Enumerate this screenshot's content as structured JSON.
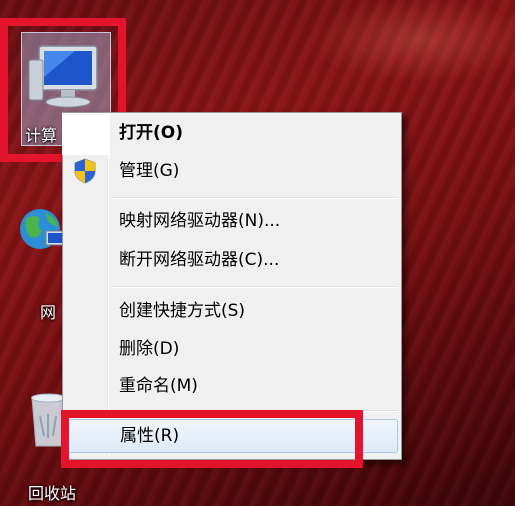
{
  "desktop": {
    "icons": [
      {
        "label": "计算机",
        "visible_label": "计算"
      },
      {
        "label": "网络",
        "visible_label": "网"
      },
      {
        "label": "回收站",
        "visible_label": "回收站"
      }
    ]
  },
  "context_menu": {
    "items": [
      {
        "label": "打开(O)",
        "bold": true
      },
      {
        "label": "管理(G)",
        "icon": "uac-shield-icon"
      },
      {
        "label": "映射网络驱动器(N)..."
      },
      {
        "label": "断开网络驱动器(C)..."
      },
      {
        "label": "创建快捷方式(S)"
      },
      {
        "label": "删除(D)"
      },
      {
        "label": "重命名(M)"
      },
      {
        "label": "属性(R)",
        "highlighted": true
      }
    ]
  },
  "colors": {
    "highlight_box": "#e3142b",
    "menu_background": "#f0f0f0",
    "menu_hover": "#dde9f6"
  }
}
